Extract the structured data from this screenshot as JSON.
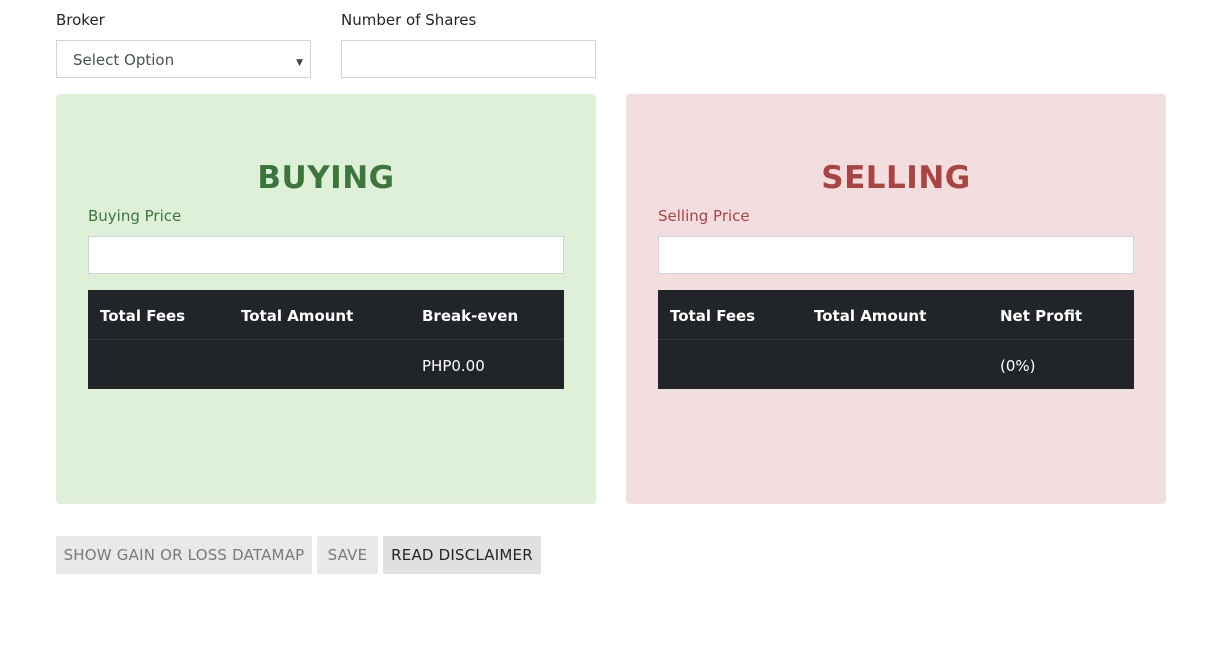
{
  "form": {
    "broker_label": "Broker",
    "broker_selected": "Select Option",
    "shares_label": "Number of Shares",
    "shares_value": ""
  },
  "buying": {
    "title": "BUYING",
    "price_label": "Buying Price",
    "price_value": "",
    "headers": [
      "Total Fees",
      "Total Amount",
      "Break-even"
    ],
    "row": [
      "",
      "",
      "PHP0.00"
    ]
  },
  "selling": {
    "title": "SELLING",
    "price_label": "Selling Price",
    "price_value": "",
    "headers": [
      "Total Fees",
      "Total Amount",
      "Net Profit"
    ],
    "row": [
      "",
      "",
      "(0%)"
    ]
  },
  "actions": {
    "datamap_label": "SHOW GAIN OR LOSS DATAMAP",
    "save_label": "SAVE",
    "disclaimer_label": "READ DISCLAIMER"
  },
  "colors": {
    "buy_panel": "#dff0d8",
    "buy_text": "#3c763d",
    "sell_panel": "#f2dede",
    "sell_text": "#a94442",
    "table_bg": "#212529"
  }
}
